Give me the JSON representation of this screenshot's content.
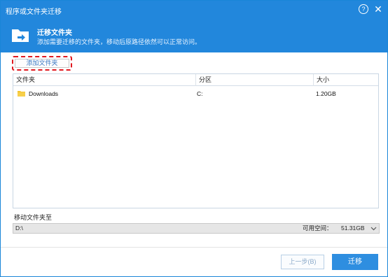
{
  "window": {
    "title": "程序或文件夹迁移",
    "help_glyph": "?",
    "close_glyph": "✕"
  },
  "banner": {
    "title": "迁移文件夹",
    "subtitle": "添加需要迁移的文件夹，移动后原路径依然可以正常访问。",
    "icon": "folder-arrow-icon"
  },
  "toolbar": {
    "add_folder_label": "添加文件夹"
  },
  "table": {
    "columns": [
      "文件夹",
      "分区",
      "大小"
    ],
    "rows": [
      {
        "name": "Downloads",
        "partition": "C:",
        "size": "1.20GB",
        "icon": "folder-icon"
      }
    ]
  },
  "destination": {
    "label": "移动文件夹至",
    "path": "D:\\",
    "free_label": "可用空间：",
    "free_value": "51.31GB"
  },
  "footer": {
    "prev_label": "上一步(B)",
    "migrate_label": "迁移"
  },
  "colors": {
    "accent": "#2287dc",
    "highlight_border": "#e0181f",
    "folder": "#f4c430"
  }
}
